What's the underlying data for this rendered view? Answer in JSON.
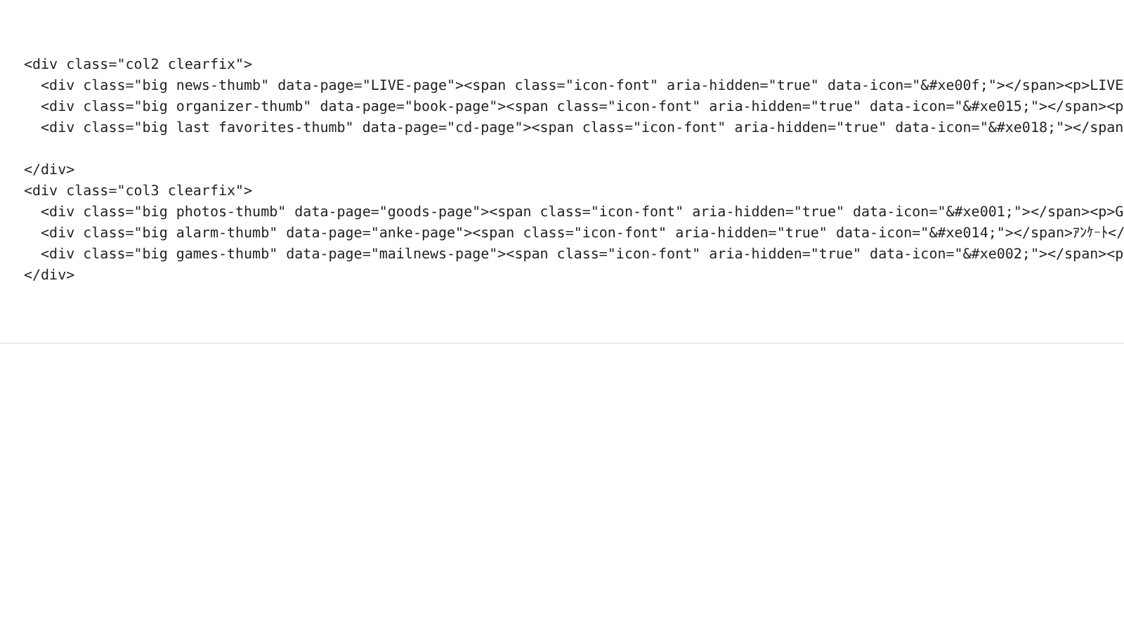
{
  "code_block": {
    "lines": [
      {
        "kind": "code",
        "text": "<div class=\"col2 clearfix\">"
      },
      {
        "kind": "code",
        "text": "  <div class=\"big news-thumb\" data-page=\"LIVE-page\"><span class=\"icon-font\" aria-hidden=\"true\" data-icon=\"&#xe00f;\"></span><p>LIVE"
      },
      {
        "kind": "code",
        "text": "  <div class=\"big organizer-thumb\" data-page=\"book-page\"><span class=\"icon-font\" aria-hidden=\"true\" data-icon=\"&#xe015;\"></span><p"
      },
      {
        "kind": "code",
        "text": "  <div class=\"big last favorites-thumb\" data-page=\"cd-page\"><span class=\"icon-font\" aria-hidden=\"true\" data-icon=\"&#xe018;\"></span"
      },
      {
        "kind": "blank"
      },
      {
        "kind": "code",
        "text": "</div>"
      },
      {
        "kind": "code",
        "text": "<div class=\"col3 clearfix\">"
      },
      {
        "kind": "code",
        "text": "  <div class=\"big photos-thumb\" data-page=\"goods-page\"><span class=\"icon-font\" aria-hidden=\"true\" data-icon=\"&#xe001;\"></span><p>G"
      },
      {
        "kind": "code",
        "text": "  <div class=\"big alarm-thumb\" data-page=\"anke-page\"><span class=\"icon-font\" aria-hidden=\"true\" data-icon=\"&#xe014;\"></span>ｱﾝｹｰﾄ</"
      },
      {
        "kind": "code",
        "text": "  <div class=\"big games-thumb\" data-page=\"mailnews-page\"><span class=\"icon-font\" aria-hidden=\"true\" data-icon=\"&#xe002;\"></span><p"
      },
      {
        "kind": "code",
        "text": "</div>"
      }
    ]
  }
}
